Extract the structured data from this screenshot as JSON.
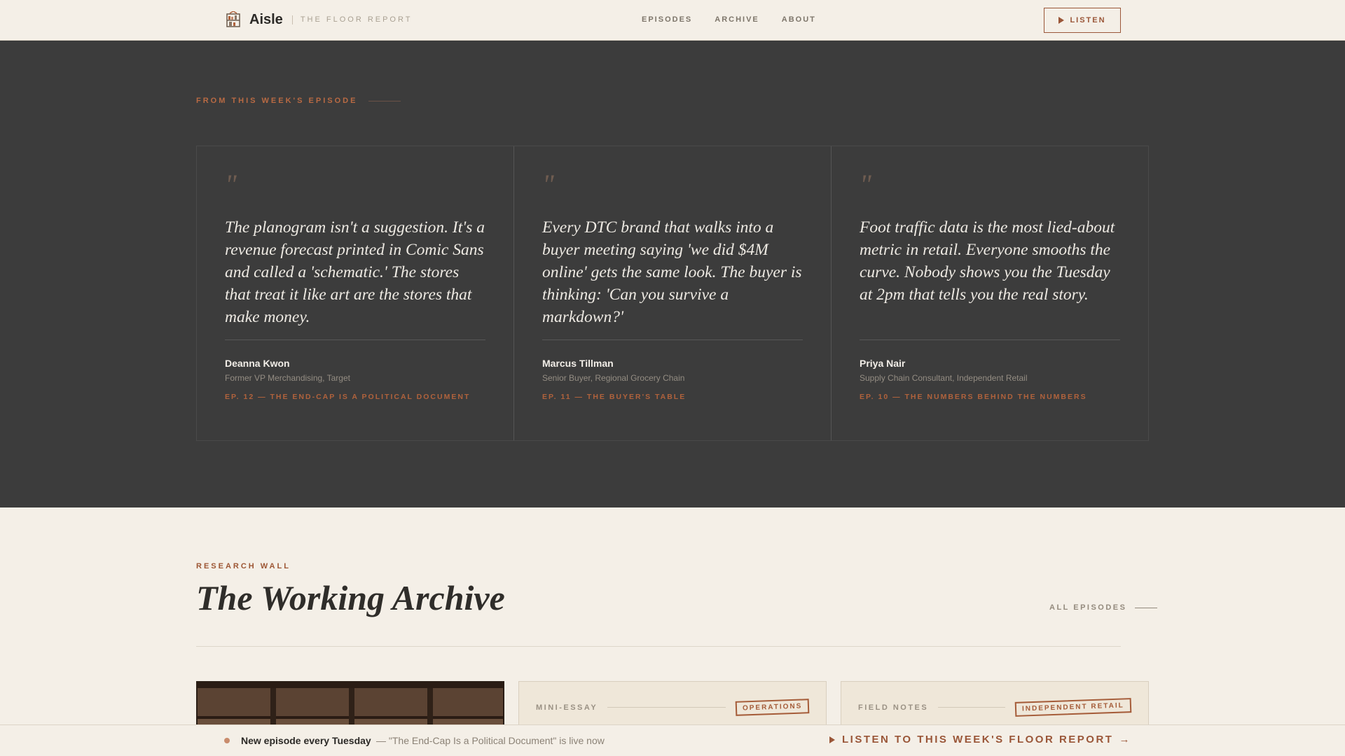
{
  "header": {
    "brand_name": "Aisle",
    "brand_tagline": "THE FLOOR REPORT",
    "nav": [
      "EPISODES",
      "ARCHIVE",
      "ABOUT"
    ],
    "listen_label": "LISTEN"
  },
  "quotes": {
    "eyebrow": "FROM THIS WEEK'S EPISODE",
    "mark": "\"",
    "items": [
      {
        "text": "The planogram isn't a suggestion. It's a revenue forecast printed in Comic Sans and called a 'schematic.' The stores that treat it like art are the stores that make money.",
        "name": "Deanna Kwon",
        "role": "Former VP Merchandising, Target",
        "episode": "EP. 12 — THE END-CAP IS A POLITICAL DOCUMENT"
      },
      {
        "text": "Every DTC brand that walks into a buyer meeting saying 'we did $4M online' gets the same look. The buyer is thinking: 'Can you survive a markdown?'",
        "name": "Marcus Tillman",
        "role": "Senior Buyer, Regional Grocery Chain",
        "episode": "EP. 11 — THE BUYER'S TABLE"
      },
      {
        "text": "Foot traffic data is the most lied-about metric in retail. Everyone smooths the curve. Nobody shows you the Tuesday at 2pm that tells you the real story.",
        "name": "Priya Nair",
        "role": "Supply Chain Consultant, Independent Retail",
        "episode": "EP. 10 — THE NUMBERS BEHIND THE NUMBERS"
      }
    ]
  },
  "research": {
    "label": "RESEARCH WALL",
    "title": "The Working Archive",
    "all_episodes": "ALL EPISODES",
    "cards": [
      {
        "kind": "MINI-ESSAY",
        "stamp": "OPERATIONS"
      },
      {
        "kind": "FIELD NOTES",
        "stamp": "INDEPENDENT RETAIL"
      }
    ]
  },
  "bottom_bar": {
    "strong": "New episode every Tuesday",
    "sub": "— \"The End-Cap Is a Political Document\" is live now",
    "cta": "LISTEN TO THIS WEEK'S FLOOR REPORT",
    "cta_arrow": "→"
  },
  "colors": {
    "accent": "#9a5638",
    "dark_band": "#3c3c3c",
    "paper": "#f4efe7"
  }
}
